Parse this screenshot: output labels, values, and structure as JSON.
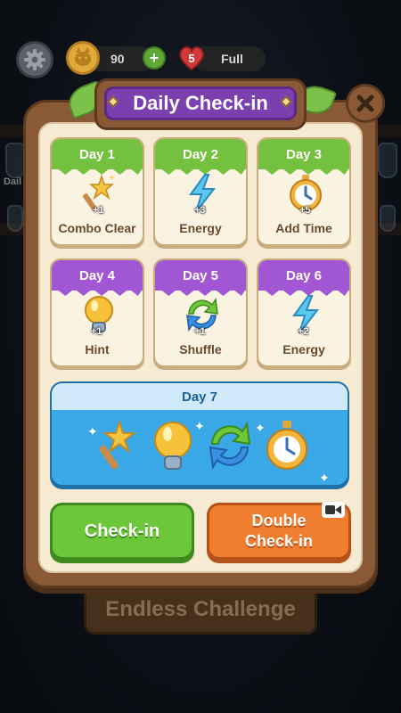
{
  "hud": {
    "coins": "90",
    "lives": "5",
    "lives_status": "Full",
    "side_label": "Dail"
  },
  "dialog": {
    "title": "Daily Check-in"
  },
  "days": [
    {
      "label": "Day 1",
      "reward": "Combo Clear",
      "qty": "+1",
      "theme": "green"
    },
    {
      "label": "Day 2",
      "reward": "Energy",
      "qty": "+3",
      "theme": "green"
    },
    {
      "label": "Day 3",
      "reward": "Add Time",
      "qty": "+5",
      "theme": "green"
    },
    {
      "label": "Day 4",
      "reward": "Hint",
      "qty": "+1",
      "theme": "purple"
    },
    {
      "label": "Day 5",
      "reward": "Shuffle",
      "qty": "+1",
      "theme": "purple"
    },
    {
      "label": "Day 6",
      "reward": "Energy",
      "qty": "+2",
      "theme": "purple"
    }
  ],
  "day7": {
    "label": "Day 7",
    "rewards": [
      "wand-icon",
      "lightbulb-icon",
      "shuffle-icon",
      "stopwatch-icon"
    ]
  },
  "buttons": {
    "checkin": "Check-in",
    "double_line1": "Double",
    "double_line2": "Check-in"
  },
  "background": {
    "endless": "Endless Challenge"
  },
  "colors": {
    "panel": "#8a5a36",
    "title": "#7b3fb0",
    "green": "#74c13f",
    "purple": "#a157d3",
    "day7": "#3aa7e6",
    "checkin": "#6cc83a",
    "double": "#f07e2e"
  }
}
